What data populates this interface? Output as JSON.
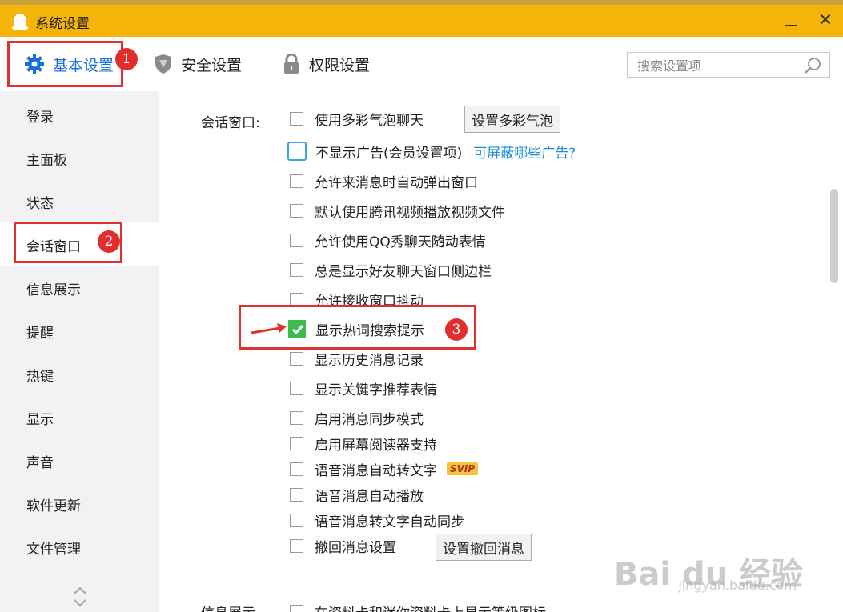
{
  "window": {
    "title": "系统设置",
    "accent": "#f5b40a"
  },
  "tabs": [
    {
      "label": "基本设置",
      "icon": "gear-icon"
    },
    {
      "label": "安全设置",
      "icon": "shield-icon"
    },
    {
      "label": "权限设置",
      "icon": "lock-icon"
    }
  ],
  "search": {
    "placeholder": "搜索设置项",
    "value": ""
  },
  "sidebar": {
    "items": [
      {
        "label": "登录"
      },
      {
        "label": "主面板"
      },
      {
        "label": "状态"
      },
      {
        "label": "会话窗口",
        "active": true
      },
      {
        "label": "信息展示"
      },
      {
        "label": "提醒"
      },
      {
        "label": "热键"
      },
      {
        "label": "显示"
      },
      {
        "label": "声音"
      },
      {
        "label": "软件更新"
      },
      {
        "label": "文件管理"
      }
    ]
  },
  "session": {
    "label": "会话窗口:",
    "options": [
      {
        "label": "使用多彩气泡聊天",
        "checked": false
      },
      {
        "label": "不显示广告(会员设置项)",
        "checked": false,
        "link": "可屏蔽哪些广告?"
      },
      {
        "label": "允许来消息时自动弹出窗口",
        "checked": false
      },
      {
        "label": "默认使用腾讯视频播放视频文件",
        "checked": false
      },
      {
        "label": "允许使用QQ秀聊天随动表情",
        "checked": false
      },
      {
        "label": "总是显示好友聊天窗口侧边栏",
        "checked": false
      },
      {
        "label": "允许接收窗口抖动",
        "checked": false
      },
      {
        "label": "显示热词搜索提示",
        "checked": true
      },
      {
        "label": "显示历史消息记录",
        "checked": false
      },
      {
        "label": "显示关键字推荐表情",
        "checked": false
      },
      {
        "label": "启用消息同步模式",
        "checked": false
      },
      {
        "label": "启用屏幕阅读器支持",
        "checked": false
      },
      {
        "label": "语音消息自动转文字",
        "checked": false,
        "badge": "SVIP"
      },
      {
        "label": "语音消息自动播放",
        "checked": false
      },
      {
        "label": "语音消息转文字自动同步",
        "checked": false
      },
      {
        "label": "撤回消息设置",
        "checked": false
      }
    ],
    "bubble_button": "设置多彩气泡",
    "recall_button": "设置撤回消息"
  },
  "info_section": {
    "label": "信息展示",
    "first_option": "在资料卡和迷你资料卡上显示等级图标"
  },
  "annotations": [
    "1",
    "2",
    "3"
  ],
  "watermark": {
    "brand": "Bai du 经验",
    "url": "jingyan.baidu.com"
  }
}
